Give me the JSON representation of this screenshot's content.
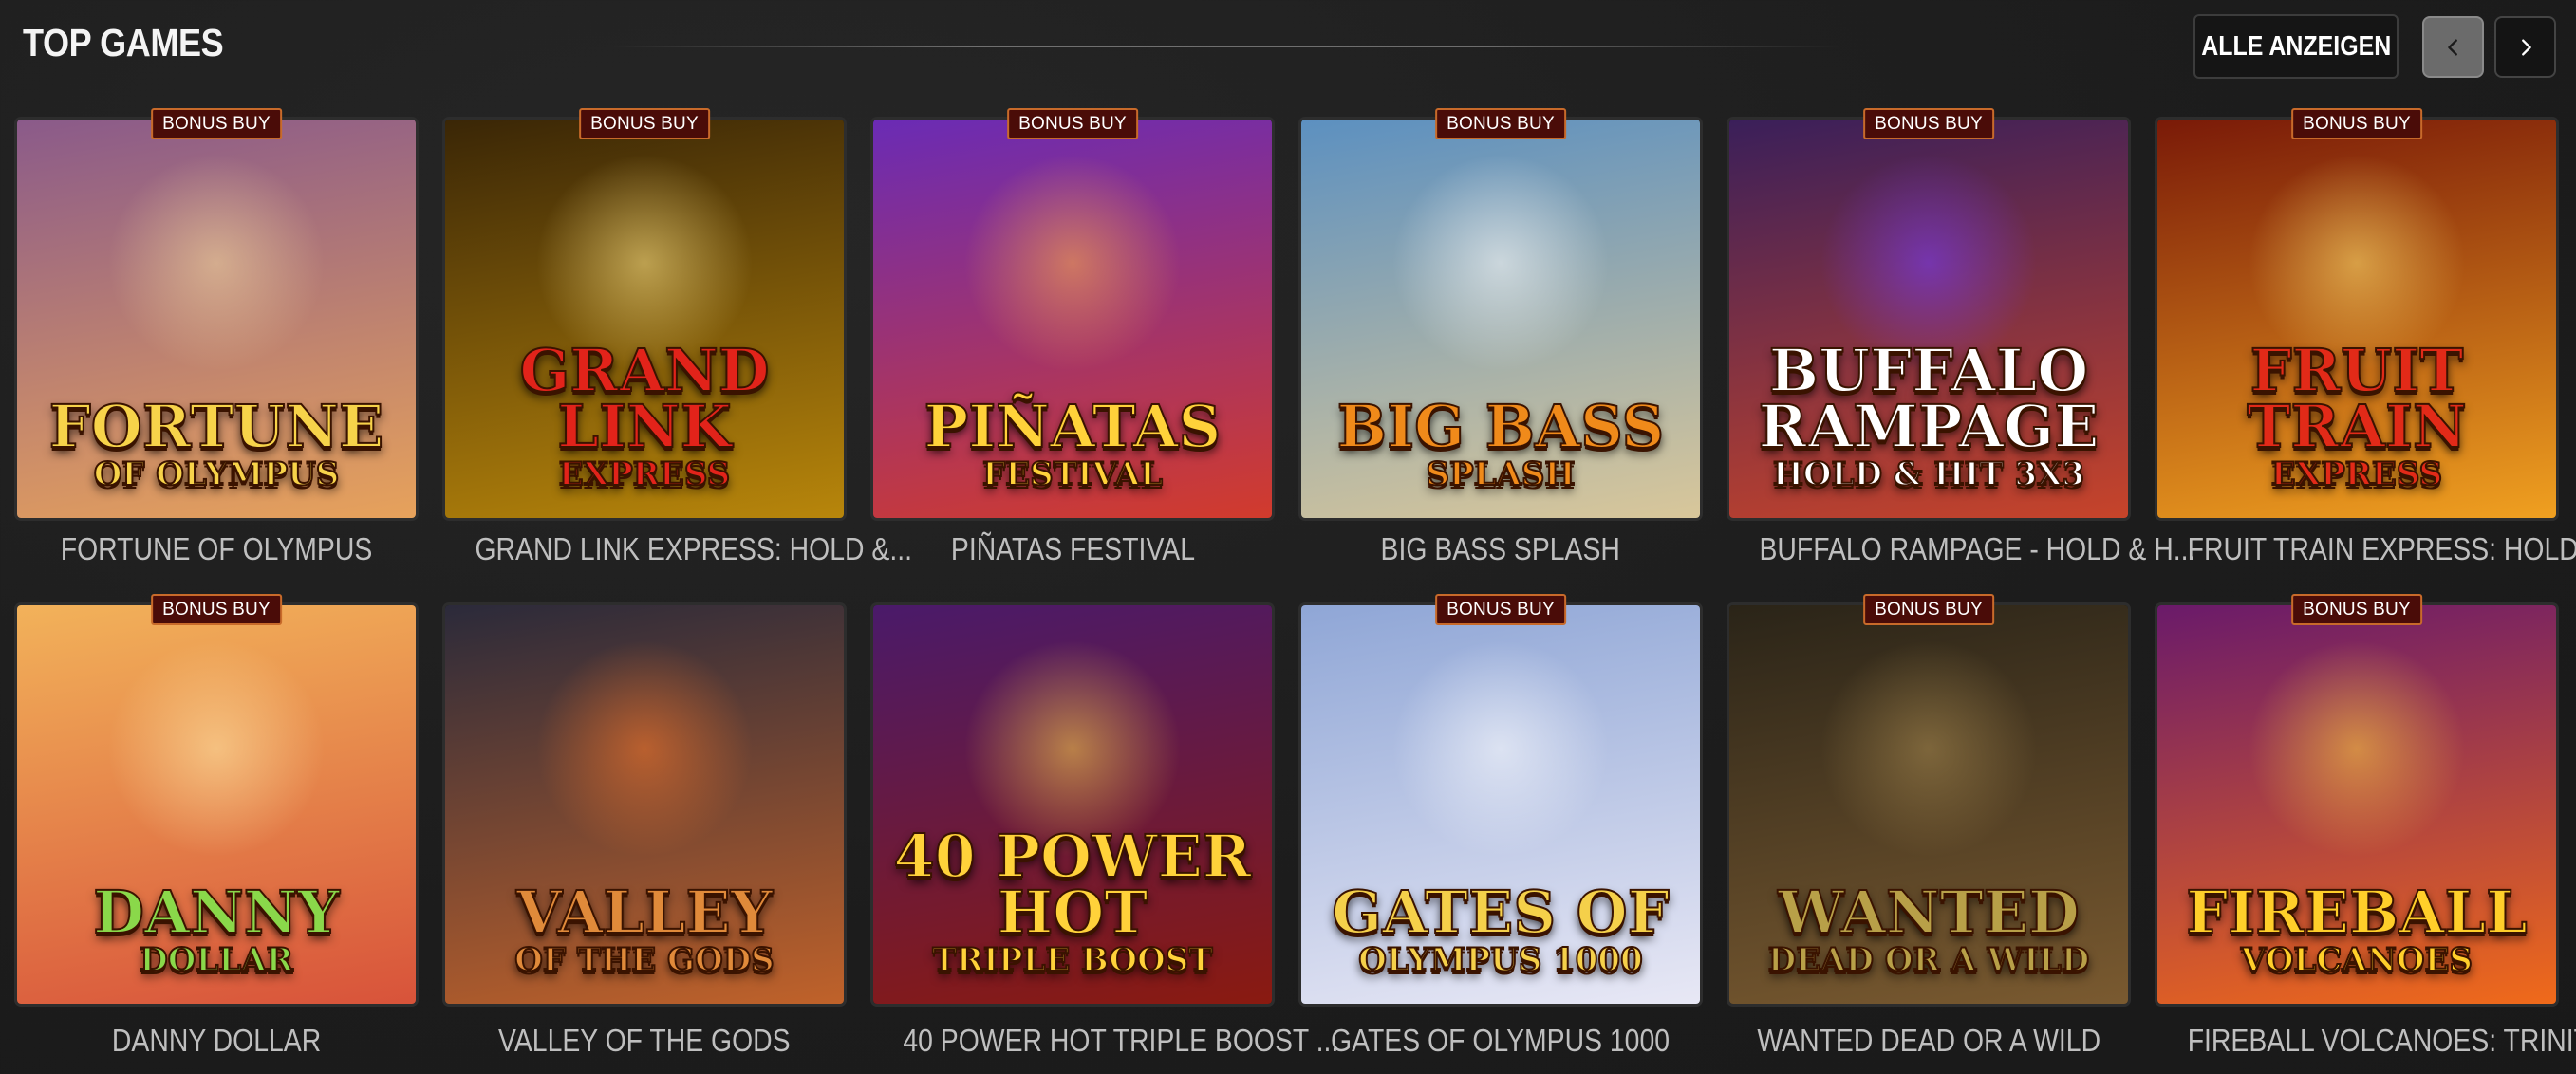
{
  "header": {
    "title": "TOP GAMES",
    "show_all_label": "ALLE ANZEIGEN"
  },
  "badge_label": "BONUS BUY",
  "games": [
    {
      "name": "FORTUNE OF OLYMPUS",
      "bonus_buy": true,
      "logo1": "FORTUNE",
      "logo2": "OF OLYMPUS",
      "bg": [
        "#8a5a8a",
        "#e7a25b"
      ],
      "glow": "#f3d9a0",
      "logo_color": "#f7d34a"
    },
    {
      "name": "GRAND LINK EXPRESS: HOLD &...",
      "bonus_buy": true,
      "logo1": "GRAND LINK",
      "logo2": "EXPRESS",
      "bg": [
        "#3a2606",
        "#b8860b"
      ],
      "glow": "#ffe58a",
      "logo_color": "#e2231a"
    },
    {
      "name": "PIÑATAS FESTIVAL",
      "bonus_buy": true,
      "logo1": "PIÑATAS",
      "logo2": "FESTIVAL",
      "bg": [
        "#6a2bb5",
        "#d23b2c"
      ],
      "glow": "#ffb04a",
      "logo_color": "#ffd23a"
    },
    {
      "name": "BIG BASS SPLASH",
      "bonus_buy": true,
      "logo1": "BIG BASS",
      "logo2": "SPLASH",
      "bg": [
        "#5c90c0",
        "#d9c79a"
      ],
      "glow": "#ffffff",
      "logo_color": "#f08a1a"
    },
    {
      "name": "BUFFALO RAMPAGE - HOLD & H...",
      "bonus_buy": true,
      "logo1": "BUFFALO RAMPAGE",
      "logo2": "HOLD & HIT 3x3",
      "bg": [
        "#3a1f5a",
        "#c7442a"
      ],
      "glow": "#7a3cff",
      "logo_color": "#ffffff"
    },
    {
      "name": "FRUIT TRAIN EXPRESS: HOLD &...",
      "bonus_buy": true,
      "logo1": "FRUIT TRAIN",
      "logo2": "EXPRESS",
      "bg": [
        "#7a1a08",
        "#f0a020"
      ],
      "glow": "#ffe070",
      "logo_color": "#e22a18"
    },
    {
      "name": "DANNY DOLLAR",
      "bonus_buy": true,
      "logo1": "DANNY",
      "logo2": "DOLLAR",
      "bg": [
        "#f2b25a",
        "#d8533a"
      ],
      "glow": "#ffe9a8",
      "logo_color": "#8ad84a"
    },
    {
      "name": "VALLEY OF THE GODS",
      "bonus_buy": false,
      "logo1": "VALLEY",
      "logo2": "OF THE GODS",
      "bg": [
        "#2b2a3a",
        "#c0622a"
      ],
      "glow": "#ff7a2a",
      "logo_color": "#e08a3a"
    },
    {
      "name": "40 POWER HOT TRIPLE BOOST ...",
      "bonus_buy": false,
      "logo1": "40 POWER HOT",
      "logo2": "TRIPLE BOOST",
      "bg": [
        "#4a1a6a",
        "#8a1a10"
      ],
      "glow": "#ffd34a",
      "logo_color": "#ffd23a"
    },
    {
      "name": "GATES OF OLYMPUS 1000",
      "bonus_buy": true,
      "logo1": "GATES OF",
      "logo2": "OLYMPUS 1000",
      "bg": [
        "#8fa6d6",
        "#e8e8f5"
      ],
      "glow": "#ffffff",
      "logo_color": "#f5d04a"
    },
    {
      "name": "WANTED DEAD OR A WILD",
      "bonus_buy": true,
      "logo1": "WANTED",
      "logo2": "DEAD OR A WILD",
      "bg": [
        "#2a2418",
        "#7a5a30"
      ],
      "glow": "#a88a50",
      "logo_color": "#b8a048"
    },
    {
      "name": "FIREBALL VOLCANOES: TRINITY...",
      "bonus_buy": true,
      "logo1": "FIREBALL",
      "logo2": "VOLCANOES",
      "bg": [
        "#6a1a6a",
        "#f06a1a"
      ],
      "glow": "#ffd040",
      "logo_color": "#ffcf2a"
    }
  ]
}
